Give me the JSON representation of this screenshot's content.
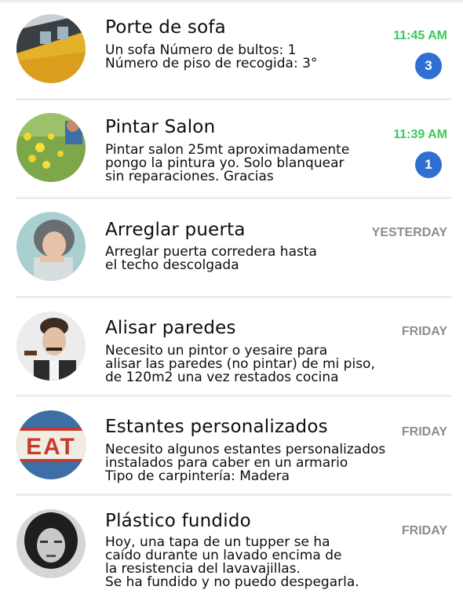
{
  "conversations": [
    {
      "title": "Porte de sofa",
      "description": "Un sofa Número de bultos: 1\nNúmero de piso de recogida: 3°",
      "time": "11:45 AM",
      "unread": "3",
      "avatar_icon": "train-photo-avatar"
    },
    {
      "title": "Pintar Salon",
      "description": "Pintar salon 25mt aproximadamente\npongo la pintura yo. Solo blanquear\nsin reparaciones. Gracias",
      "time": "11:39 AM",
      "unread": "1",
      "avatar_icon": "flowers-photo-avatar"
    },
    {
      "title": "Arreglar puerta",
      "description": "Arreglar puerta corredera hasta\nel techo descolgada",
      "time": "YESTERDAY",
      "unread": null,
      "avatar_icon": "woman-photo-avatar"
    },
    {
      "title": "Alisar paredes",
      "description": "Necesito un pintor o yesaire para\nalisar las paredes (no pintar) de mi piso,\nde 120m2 una vez restados cocina",
      "time": "FRIDAY",
      "unread": null,
      "avatar_icon": "man-photo-avatar"
    },
    {
      "title": "Estantes personalizados",
      "description": "Necesito algunos estantes personalizados\ninstalados para caber en un armario\nTipo de carpintería: Madera",
      "time": "FRIDAY",
      "unread": null,
      "avatar_icon": "eat-sign-photo-avatar",
      "avatar_text": "EAT"
    },
    {
      "title": "Plástico fundido",
      "description": "Hoy, una tapa de un tupper se ha\ncaído durante un lavado encima de\nla resistencia del lavavajillas.\nSe ha fundido y no puedo despegarla.",
      "time": "FRIDAY",
      "unread": null,
      "avatar_icon": "woman-bw-photo-avatar"
    }
  ],
  "colors": {
    "time_recent": "#3bc95a",
    "time_old": "#8d8d8d",
    "badge": "#2f6fd1",
    "divider": "#ededed"
  }
}
